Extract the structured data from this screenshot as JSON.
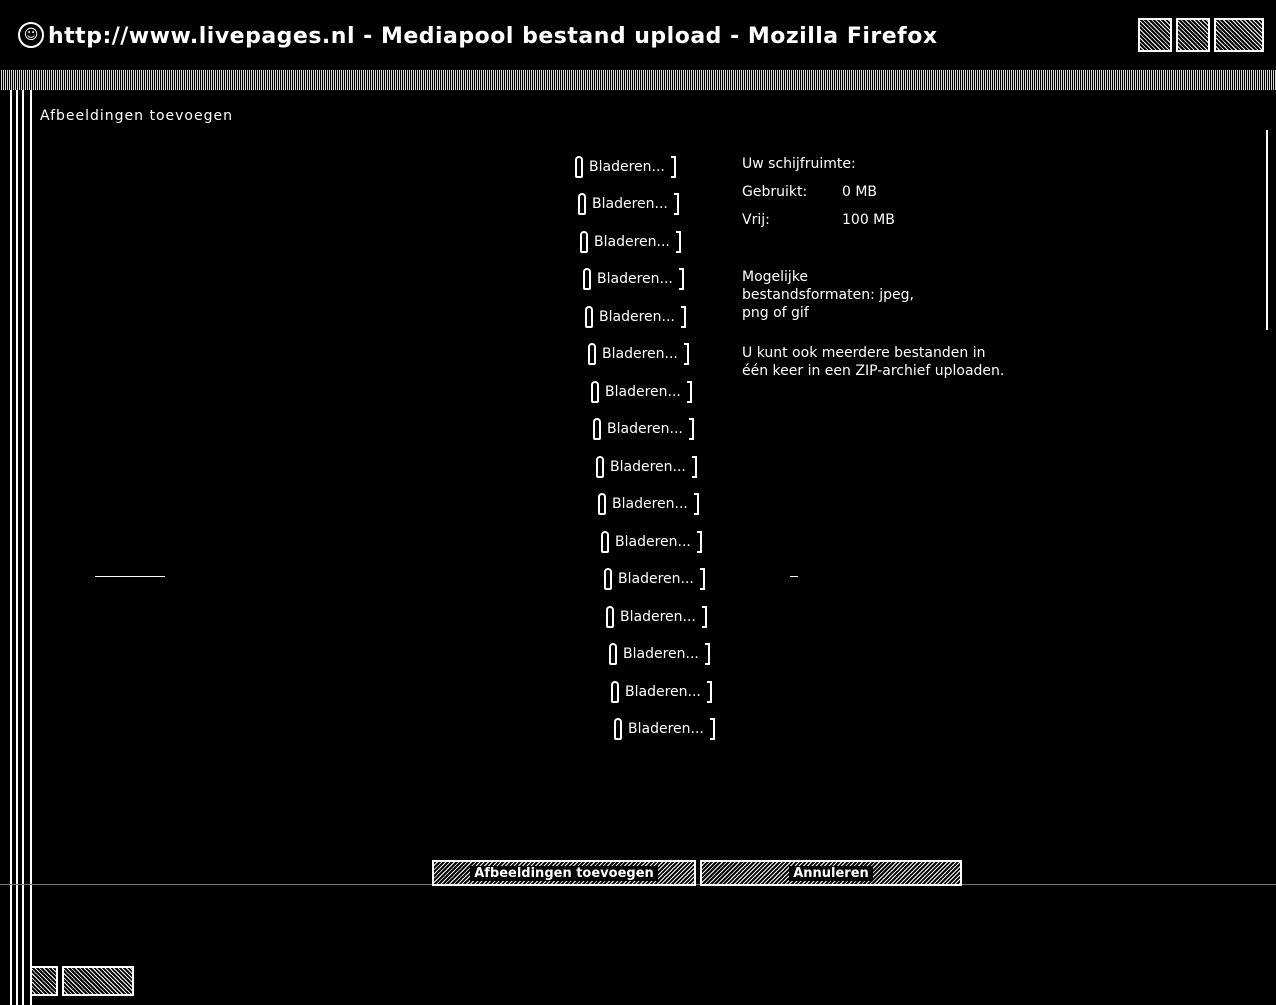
{
  "window": {
    "title": "http://www.livepages.nl - Mediapool bestand upload - Mozilla Firefox"
  },
  "page": {
    "heading": "Afbeeldingen toevoegen"
  },
  "file_inputs": [
    "Bladeren...",
    "Bladeren...",
    "Bladeren...",
    "Bladeren...",
    "Bladeren...",
    "Bladeren...",
    "Bladeren...",
    "Bladeren...",
    "Bladeren...",
    "Bladeren...",
    "Bladeren...",
    "Bladeren...",
    "Bladeren...",
    "Bladeren...",
    "Bladeren...",
    "Bladeren..."
  ],
  "info": {
    "disk_title": "Uw schijfruimte:",
    "used_label": "Gebruikt:",
    "used_value": "0 MB",
    "free_label": "Vrij:",
    "free_value": "100 MB",
    "formats_text": "Mogelijke bestandsformaten: jpeg, png of gif",
    "zip_text": "U kunt ook meerdere bestanden in één keer in een ZIP-archief uploaden."
  },
  "buttons": {
    "add": "Afbeeldingen toevoegen",
    "cancel": "Annuleren"
  }
}
